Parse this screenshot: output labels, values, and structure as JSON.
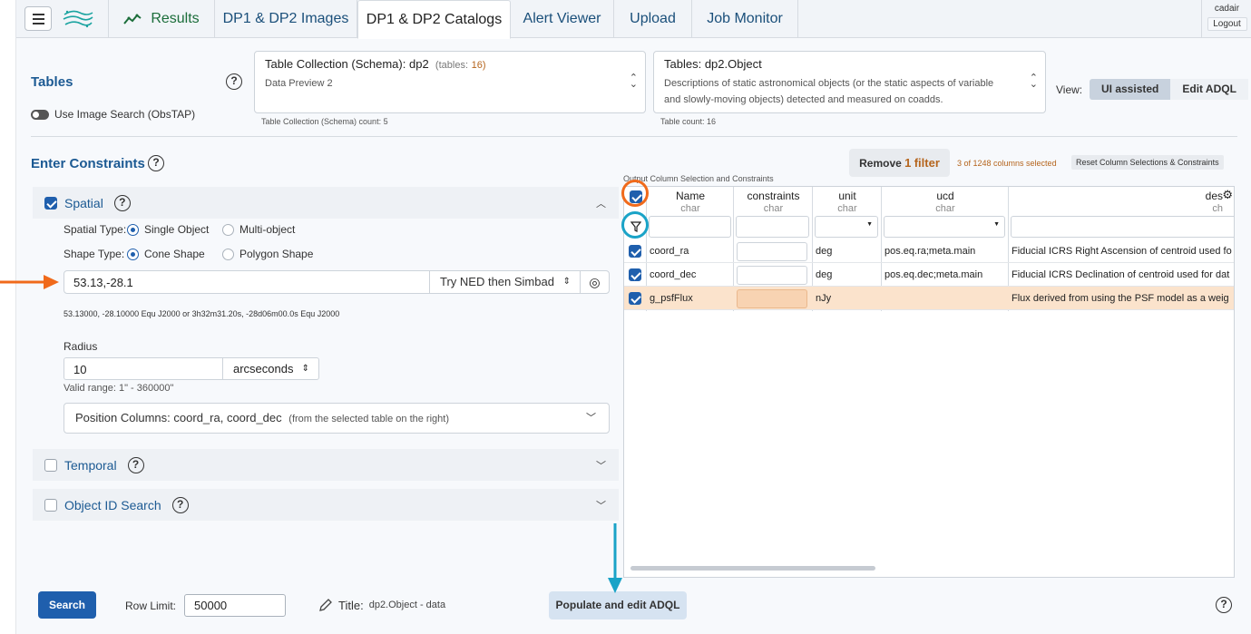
{
  "nav": {
    "tabs": [
      "Results",
      "DP1 & DP2 Images",
      "DP1 & DP2 Catalogs",
      "Alert Viewer",
      "Upload",
      "Job Monitor"
    ],
    "active_tab": "DP1 & DP2 Catalogs",
    "user": "cadair",
    "logout": "Logout"
  },
  "tables": {
    "heading": "Tables",
    "image_search_toggle": "Use Image Search (ObsTAP)",
    "schema_label": "Table Collection (Schema):",
    "schema_value": "dp2",
    "schema_tables_label": "(tables:",
    "schema_tables_count": "16)",
    "schema_desc": "Data Preview 2",
    "schema_count_note": "Table Collection (Schema) count: 5",
    "table_label": "Tables:",
    "table_value": "dp2.Object",
    "table_desc_1": "Descriptions of static astronomical objects (or the static aspects of variable",
    "table_desc_2": "and slowly-moving objects) detected and measured on coadds.",
    "table_count_note": "Table count: 16",
    "view_label": "View:",
    "view_options": [
      "UI assisted",
      "Edit ADQL"
    ],
    "view_selected": "UI assisted"
  },
  "constraints": {
    "heading": "Enter Constraints",
    "spatial": {
      "title": "Spatial",
      "checked": true,
      "spatial_type_label": "Spatial Type:",
      "spatial_types": [
        "Single Object",
        "Multi-object"
      ],
      "spatial_type_selected": "Single Object",
      "shape_type_label": "Shape Type:",
      "shape_types": [
        "Cone Shape",
        "Polygon Shape"
      ],
      "shape_type_selected": "Cone Shape",
      "position_value": "53.13,-28.1",
      "resolver": "Try NED then Simbad",
      "coord_note": "53.13000, -28.10000  Equ J2000    or    3h32m31.20s, -28d06m00.0s  Equ J2000",
      "radius_label": "Radius",
      "radius_value": "10",
      "radius_unit": "arcseconds",
      "valid_range": "Valid range: 1\" - 360000\"",
      "position_columns_label": "Position Columns:",
      "position_columns_value": "coord_ra, coord_dec",
      "position_columns_note": "(from the selected table on the right)"
    },
    "temporal": {
      "title": "Temporal",
      "checked": false
    },
    "object_id": {
      "title": "Object ID Search",
      "checked": false
    }
  },
  "columns": {
    "remove_filter_prefix": "Remove",
    "remove_filter_count": "1",
    "remove_filter_suffix": "filter",
    "selected_count": "3 of 1248 columns selected",
    "reset_label": "Reset Column Selections & Constraints",
    "panel_label": "Output Column Selection and Constraints",
    "headers": [
      {
        "name": "Name",
        "type": "char"
      },
      {
        "name": "constraints",
        "type": "char"
      },
      {
        "name": "unit",
        "type": "char"
      },
      {
        "name": "ucd",
        "type": "char"
      },
      {
        "name": "des",
        "type": "ch"
      }
    ],
    "rows": [
      {
        "name": "coord_ra",
        "unit": "deg",
        "ucd": "pos.eq.ra;meta.main",
        "desc": "Fiducial ICRS Right Ascension of centroid used fo",
        "checked": true,
        "highlight": false
      },
      {
        "name": "coord_dec",
        "unit": "deg",
        "ucd": "pos.eq.dec;meta.main",
        "desc": "Fiducial ICRS Declination of centroid used for dat",
        "checked": true,
        "highlight": false
      },
      {
        "name": "g_psfFlux",
        "unit": "nJy",
        "ucd": "",
        "desc": "Flux derived from using the PSF model as a weig",
        "checked": true,
        "highlight": true
      }
    ]
  },
  "footer": {
    "search_label": "Search",
    "row_limit_label": "Row Limit:",
    "row_limit_value": "50000",
    "title_label": "Title:",
    "title_value": "dp2.Object - data",
    "populate_label": "Populate and edit ADQL"
  },
  "colors": {
    "accent": "#1f5fad",
    "link": "#1c5a93",
    "highlight_row": "#fbe3cc",
    "annotation_orange": "#f06a1b",
    "annotation_blue": "#1aa3c7"
  }
}
